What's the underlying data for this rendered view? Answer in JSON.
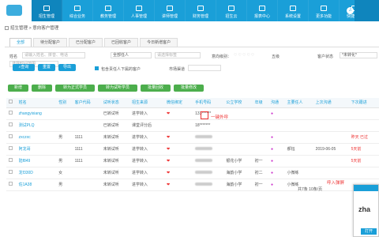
{
  "nav": {
    "items": [
      "招生管理",
      "综合业务",
      "教务管理",
      "人事管理",
      "讲师管理",
      "财务管理",
      "招生云",
      "报表中心",
      "系统设置",
      "更多功能",
      "快捷方式"
    ],
    "active_index": 0
  },
  "breadcrumb": "招生管理 > 意向客户管理",
  "tabs": [
    "全部",
    "待分配客户",
    "已分配客户",
    "已回收客户",
    "今日新增客户"
  ],
  "filters": {
    "name_label": "姓名",
    "name_placeholder": "请输入姓名、拼音、电话",
    "owner_value": "全部任人",
    "tag_placeholder": "请选择标签",
    "intent_label": "意向级别：",
    "intent_extra": "五级",
    "source_label": "客户状态",
    "source_value": "*未转化*",
    "date_placeholder": "选择时间范围"
  },
  "actions": {
    "search": "查询",
    "reset": "重置",
    "export": "导出",
    "include_label": "包含责任人下属的客户",
    "market_label": "市场渠道",
    "add": "新增",
    "delete": "删除",
    "to_formal": "转为正式学员",
    "to_trial": "转为试听学员",
    "recycle": "批量回收",
    "batch_edit": "批量修改"
  },
  "table": {
    "headers": [
      "",
      "姓名",
      "性别",
      "客户代码",
      "试听状态",
      "招生来源",
      "微信绑定",
      "手机号码",
      "公立学校",
      "年级",
      "沟通",
      "主要任人",
      "上次沟通",
      "下次跟进"
    ],
    "rows": [
      {
        "name": "zhangyixiang",
        "gender": "",
        "code": "",
        "trial": "已转试听",
        "source": "进学转入",
        "wechat": "❤",
        "phone": "133******",
        "school": "",
        "grade": "",
        "comm": "●",
        "owner": "",
        "last": "",
        "next": ""
      },
      {
        "name": "测试PLQ",
        "gender": "",
        "code": "",
        "trial": "已转试听",
        "source": "课堂评分后",
        "wechat": "",
        "phone": "18*******",
        "school": "",
        "grade": "",
        "comm": "",
        "owner": "",
        "last": "",
        "next": ""
      },
      {
        "name": "zxczxc",
        "gender": "男",
        "code": "1111",
        "trial": "未转试听",
        "source": "进学转入",
        "wechat": "❤",
        "phone": "",
        "school": "",
        "grade": "",
        "comm": "●",
        "owner": "",
        "last": "",
        "next": "昨天 已过"
      },
      {
        "name": "阿龙哥",
        "gender": "",
        "code": "1111",
        "trial": "未转试听",
        "source": "进学转入",
        "wechat": "❤",
        "phone": "",
        "school": "",
        "grade": "",
        "comm": "●",
        "owner": "郝钰",
        "last": "2019-06-05",
        "next": "5天前"
      },
      {
        "name": "陆f849",
        "gender": "男",
        "code": "1111",
        "trial": "未转试听",
        "source": "进学转入",
        "wechat": "❤",
        "phone": "",
        "school": "银花小学",
        "grade": "初一",
        "comm": "●",
        "owner": "",
        "last": "",
        "next": "5天前"
      },
      {
        "name": "龙f330D",
        "gender": "女",
        "code": "",
        "trial": "未转试听",
        "source": "进学转入",
        "wechat": "❤",
        "phone": "",
        "school": "海韵小学",
        "grade": "初二",
        "comm": "●",
        "owner": "小微练",
        "last": "",
        "next": ""
      },
      {
        "name": "佐1A38",
        "gender": "男",
        "code": "",
        "trial": "未转试听",
        "source": "进学转入",
        "wechat": "❤",
        "phone": "",
        "school": "海韵小学",
        "grade": "初一",
        "comm": "●",
        "owner": "小微练",
        "last": "",
        "next": ""
      }
    ]
  },
  "annotations": {
    "one_click": "一键外呼",
    "calling": "呼入弹屏"
  },
  "pager": "共7条  10条/页",
  "popup": {
    "name": "zha",
    "open_label": "打开"
  }
}
